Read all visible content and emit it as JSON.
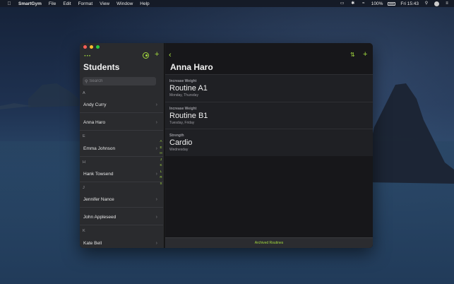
{
  "menubar": {
    "app_name": "SmartGym",
    "menus": [
      "File",
      "Edit",
      "Format",
      "View",
      "Window",
      "Help"
    ],
    "battery": "100%",
    "clock": "Fri 15:43"
  },
  "sidebar": {
    "title": "Students",
    "search_placeholder": "Search",
    "sections": [
      {
        "letter": "A",
        "students": [
          "Andy Curry",
          "Anna Haro"
        ]
      },
      {
        "letter": "E",
        "students": [
          "Emma Johnson"
        ]
      },
      {
        "letter": "H",
        "students": [
          "Hank Towsend"
        ]
      },
      {
        "letter": "J",
        "students": [
          "Jennifer Nance",
          "John Appleseed"
        ]
      },
      {
        "letter": "K",
        "students": [
          "Kate Bell"
        ]
      }
    ],
    "index_letters": [
      "A",
      "E",
      "H",
      "J",
      "K",
      "L",
      "R",
      "S"
    ]
  },
  "detail": {
    "title": "Anna Haro",
    "routines": [
      {
        "category": "Increase Weight",
        "name": "Routine A1",
        "days": "Monday, Thursday"
      },
      {
        "category": "Increase Weight",
        "name": "Routine B1",
        "days": "Tuesday, Friday"
      },
      {
        "category": "Strength",
        "name": "Cardio",
        "days": "Wednesday"
      }
    ],
    "footer_label": "Archived Routines"
  },
  "colors": {
    "accent": "#a3d93e",
    "sidebar_bg": "#2a2b2e",
    "main_bg": "#17171a"
  }
}
